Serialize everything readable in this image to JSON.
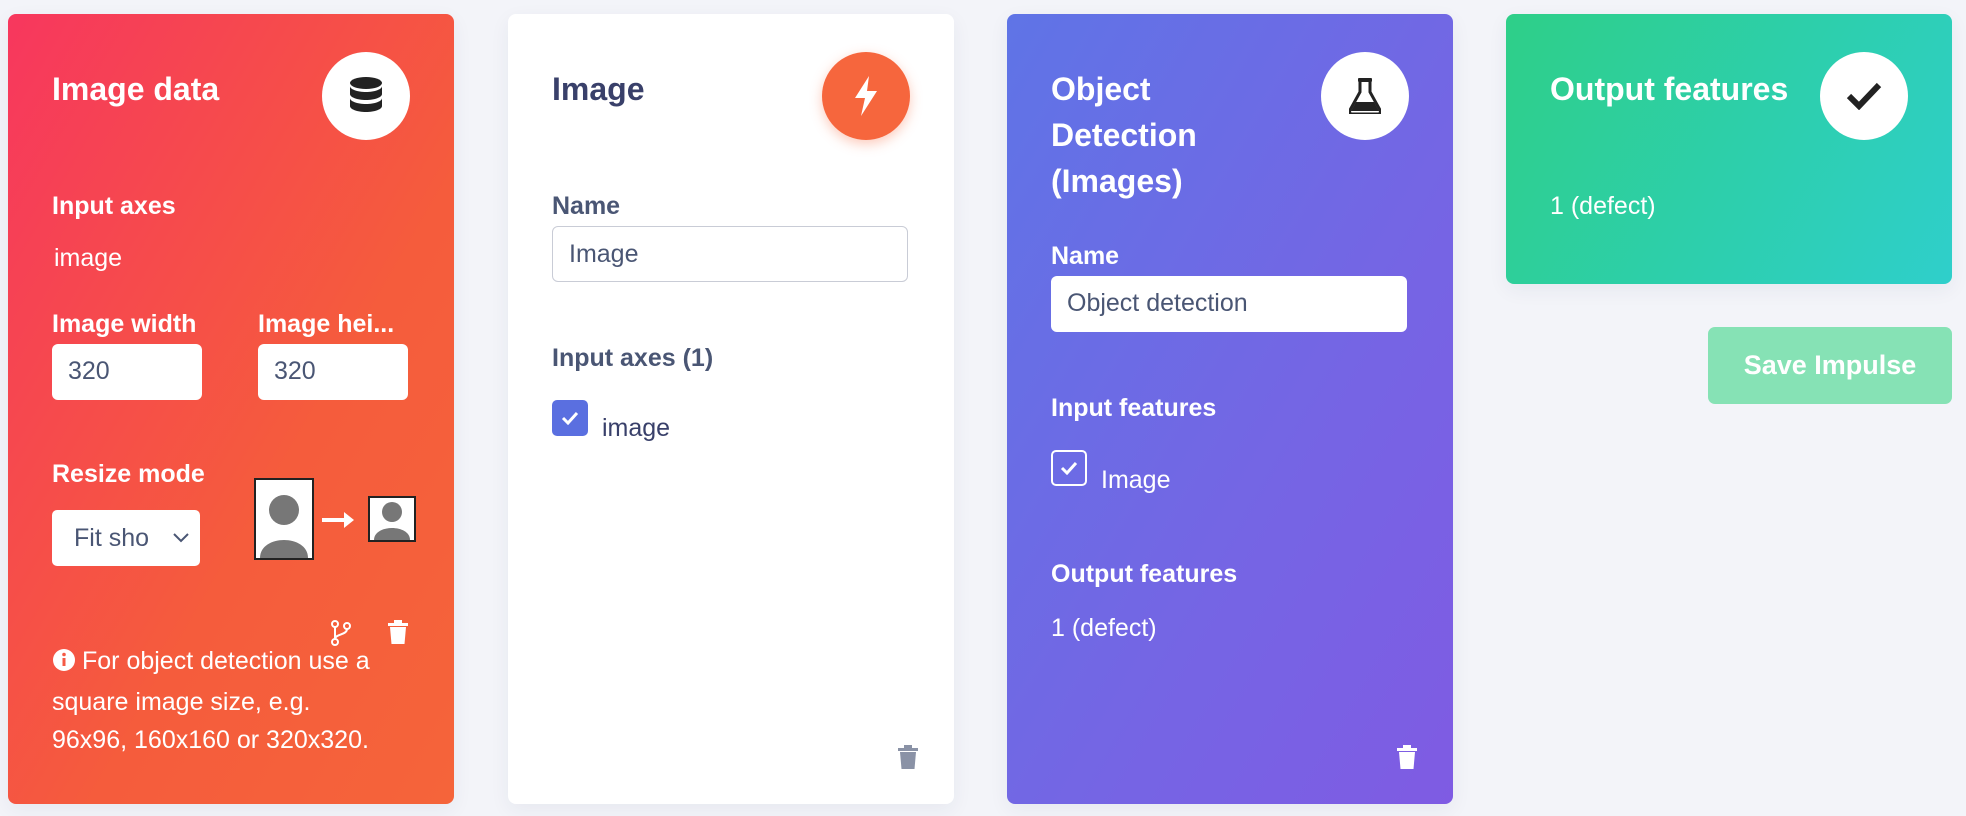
{
  "image_data": {
    "title": "Image data",
    "icon": "database-icon",
    "input_axes_label": "Input axes",
    "input_axes_value": "image",
    "width_label": "Image width",
    "width_value": "320",
    "height_label": "Image hei...",
    "height_value": "320",
    "resize_label": "Resize mode",
    "resize_selected": "Fit sho",
    "info": "For object detection use a square image size, e.g. 96x96, 160x160 or 320x320."
  },
  "image_block": {
    "title": "Image",
    "icon": "bolt-icon",
    "name_label": "Name",
    "name_value": "Image",
    "axes_label": "Input axes (1)",
    "axes": [
      {
        "label": "image",
        "checked": true
      }
    ]
  },
  "learn_block": {
    "title": "Object Detection (Images)",
    "icon": "flask-icon",
    "name_label": "Name",
    "name_value": "Object detection",
    "input_features_label": "Input features",
    "input_features": [
      {
        "label": "Image",
        "checked": true
      }
    ],
    "output_features_label": "Output features",
    "output_features_value": "1 (defect)"
  },
  "output_block": {
    "title": "Output features",
    "icon": "check-icon",
    "value": "1 (defect)"
  },
  "save_button": "Save Impulse",
  "colors": {
    "card1_gradient": [
      "#f7375e",
      "#f5643a"
    ],
    "card2_accent": "#f6663d",
    "card3_gradient": [
      "#5f74e6",
      "#7f5be3"
    ],
    "card4_gradient": [
      "#2ecf88",
      "#2fcfcb"
    ],
    "save_button": "#86e2b5",
    "checkbox": "#5a6fe0"
  }
}
